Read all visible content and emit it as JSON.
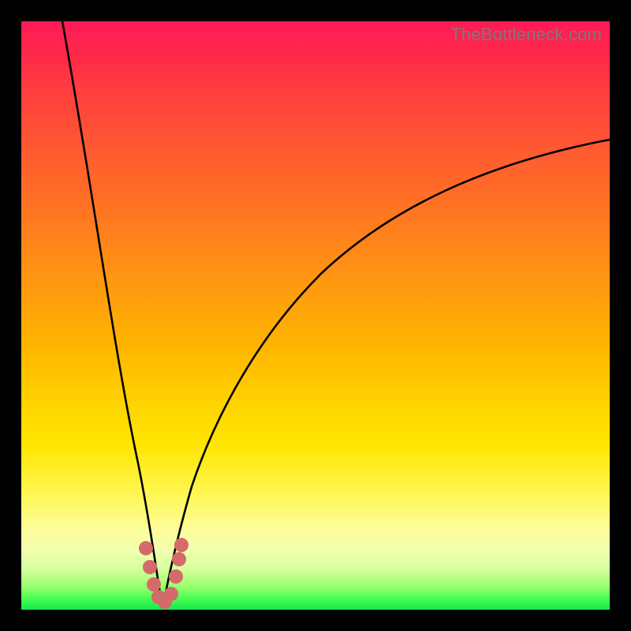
{
  "watermark": "TheBottleneck.com",
  "colors": {
    "frame": "#000000",
    "gradient_top": "#ff1a55",
    "gradient_mid": "#ffd000",
    "gradient_bottom": "#15e94a",
    "curve": "#000000",
    "marker": "#d46a6a"
  },
  "chart_data": {
    "type": "line",
    "title": "",
    "xlabel": "",
    "ylabel": "",
    "xlim": [
      0,
      100
    ],
    "ylim": [
      0,
      100
    ],
    "note": "Bottleneck-style V-curve. x is a normalized hardware balance axis (0–100); y is bottleneck magnitude % (0 = no bottleneck, 100 = full bottleneck). Minimum near x≈23 at y≈0. Values estimated from pixel positions against the plot area.",
    "series": [
      {
        "name": "left-branch",
        "x": [
          7,
          10,
          13,
          16,
          18,
          20,
          21,
          22,
          23
        ],
        "values": [
          100,
          80,
          60,
          40,
          26,
          14,
          8,
          3,
          0
        ]
      },
      {
        "name": "right-branch",
        "x": [
          23,
          25,
          28,
          32,
          38,
          45,
          55,
          68,
          82,
          100
        ],
        "values": [
          0,
          5,
          14,
          26,
          40,
          52,
          63,
          72,
          77,
          80
        ]
      }
    ],
    "markers": {
      "name": "highlighted-points",
      "x": [
        20.5,
        21.2,
        22.0,
        23.0,
        24.0,
        24.8,
        25.3,
        25.6
      ],
      "values": [
        10,
        6,
        3,
        1,
        2,
        5,
        8,
        11
      ]
    }
  }
}
